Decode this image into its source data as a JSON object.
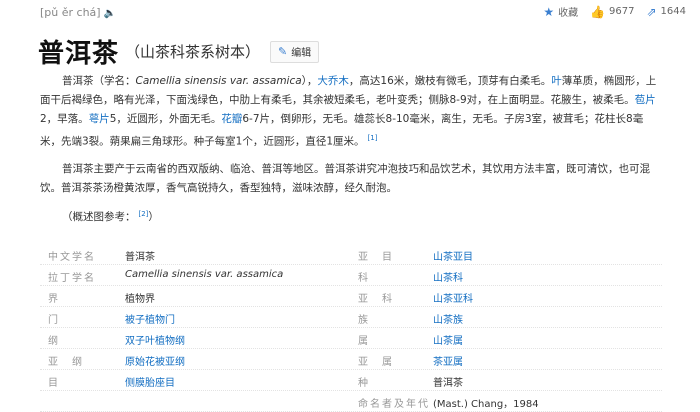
{
  "header": {
    "pinyin": "[pǔ ěr chá]",
    "title": "普洱茶",
    "subtitle": "（山茶科茶系树本）",
    "edit_label": "编辑",
    "collect_label": "收藏",
    "like_count": "9677",
    "share_count": "1644"
  },
  "intro": {
    "p1_a": "普洱茶（学名：",
    "p1_latin": "Camellia sinensis var. assamica",
    "p1_b": "），",
    "p1_link1": "大乔木",
    "p1_c": "，高达16米，嫩枝有微毛，顶芽有白柔毛。",
    "p1_link2": "叶",
    "p1_d": "薄革质，椭圆形，上面干后褐绿色，略有光泽，下面浅绿色，中肋上有柔毛，其余被短柔毛，老叶变秃；侧脉8-9对，在上面明显。花腋生，被柔毛。",
    "p1_link3": "苞片",
    "p1_e": "2，早落。",
    "p1_link4": "萼片",
    "p1_f": "5，近圆形，外面无毛。",
    "p1_link5": "花瓣",
    "p1_g": "6-7片，倒卵形，无毛。雄蕊长8-10毫米，离生，无毛。子房3室，被茸毛；花柱长8毫米，先端3裂。蒴果扁三角球形。种子每室1个，近圆形，直径1厘米。",
    "p1_ref": "[1]",
    "p2": "普洱茶主要产于云南省的西双版纳、临沧、普洱等地区。普洱茶讲究冲泡技巧和品饮艺术，其饮用方法丰富，既可清饮，也可混饮。普洱茶茶汤橙黄浓厚，香气高锐持久，香型独特，滋味浓醇，经久耐泡。",
    "image_ref_label": "（概述图参考：",
    "image_ref_sup": "[2]",
    "image_ref_close": "）"
  },
  "info": [
    {
      "k1": "中文学名",
      "v1": "普洱茶",
      "l1": false,
      "it1": false,
      "k2": "亚　目",
      "v2": "山茶亚目",
      "l2": true
    },
    {
      "k1": "拉丁学名",
      "v1": "Camellia sinensis var. assamica",
      "l1": false,
      "it1": true,
      "k2": "科",
      "v2": "山茶科",
      "l2": true
    },
    {
      "k1": "界",
      "v1": "植物界",
      "l1": false,
      "it1": false,
      "k2": "亚　科",
      "v2": "山茶亚科",
      "l2": true
    },
    {
      "k1": "门",
      "v1": "被子植物门",
      "l1": true,
      "it1": false,
      "k2": "族",
      "v2": "山茶族",
      "l2": true
    },
    {
      "k1": "纲",
      "v1": "双子叶植物纲",
      "l1": true,
      "it1": false,
      "k2": "属",
      "v2": "山茶属",
      "l2": true
    },
    {
      "k1": "亚　纲",
      "v1": "原始花被亚纲",
      "l1": true,
      "it1": false,
      "k2": "亚　属",
      "v2": "茶亚属",
      "l2": true
    },
    {
      "k1": "目",
      "v1": "侧膜胎座目",
      "l1": true,
      "it1": false,
      "k2": "种",
      "v2": "普洱茶",
      "l2": false
    },
    {
      "k1": "",
      "v1": "",
      "l1": false,
      "it1": false,
      "k2": "命名者及年代",
      "v2": "(Mast.) Chang，1984",
      "l2": false
    }
  ],
  "colors": {
    "link": "#136ec2",
    "accent": "#3a7fd0"
  },
  "icons": {
    "speaker": "speaker-icon",
    "star": "star-icon",
    "thumb": "thumbs-up-icon",
    "share": "share-icon",
    "pen": "pencil-icon"
  }
}
